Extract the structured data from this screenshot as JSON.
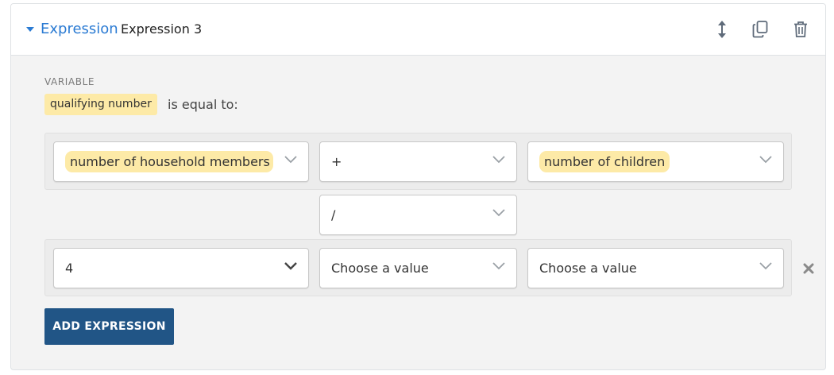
{
  "header": {
    "toggle_label": "Expression",
    "name": "Expression 3",
    "icons": [
      "move-vertical-icon",
      "copy-icon",
      "trash-icon"
    ]
  },
  "variable": {
    "section_label": "VARIABLE",
    "name": "qualifying number",
    "relation": "is equal to:"
  },
  "expression_rows": [
    {
      "operand_left": "number of household members",
      "operator": "+",
      "operand_right": "number of children"
    },
    {
      "operator_between": "/"
    },
    {
      "operand_left": "4",
      "operator": "Choose a value",
      "operand_right": "Choose a value"
    }
  ],
  "buttons": {
    "add_expression": "ADD EXPRESSION"
  },
  "colors": {
    "accent": "#2b7bd3",
    "variable_highlight": "#fdeaa7",
    "button_bg": "#215586",
    "panel_bg": "#f3f3f3"
  }
}
